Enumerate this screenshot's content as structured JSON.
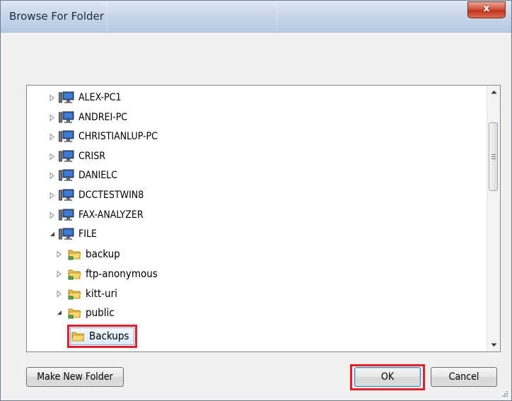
{
  "window": {
    "title": "Browse For Folder",
    "close_label": "x"
  },
  "tree": {
    "computers": [
      "ALEX-PC1",
      "ANDREI-PC",
      "CHRISTIANLUP-PC",
      "CRISR",
      "DANIELC",
      "DCCTESTWIN8",
      "FAX-ANALYZER"
    ],
    "expanded_computer": "FILE",
    "shares": [
      "backup",
      "ftp-anonymous",
      "kitt-uri"
    ],
    "expanded_share": "public",
    "selected_folder": "Backups"
  },
  "buttons": {
    "make_new_folder": "Make New Folder",
    "ok": "OK",
    "cancel": "Cancel"
  },
  "colors": {
    "highlight": "#e21e26",
    "dialog_background": "#f0f0f0",
    "selection_fill": "#dcebfc"
  }
}
